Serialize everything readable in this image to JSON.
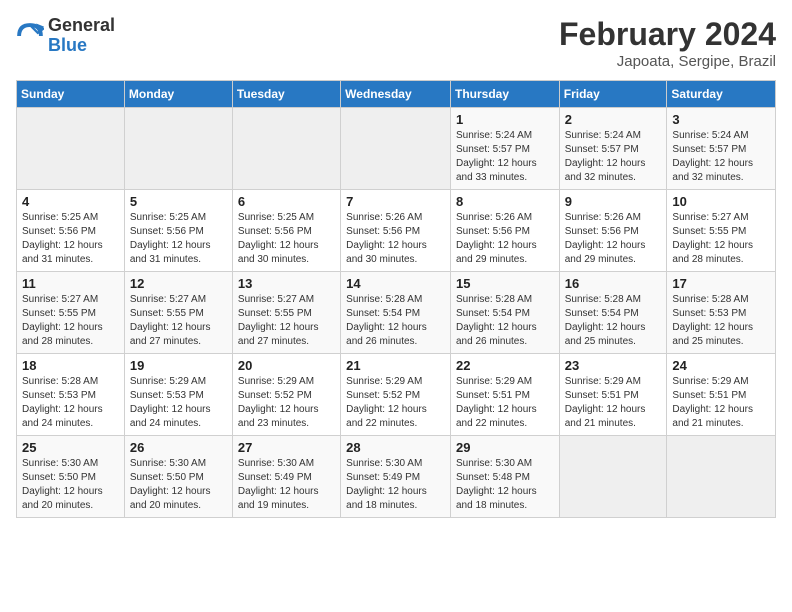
{
  "logo": {
    "line1": "General",
    "line2": "Blue"
  },
  "title": "February 2024",
  "location": "Japoata, Sergipe, Brazil",
  "headers": [
    "Sunday",
    "Monday",
    "Tuesday",
    "Wednesday",
    "Thursday",
    "Friday",
    "Saturday"
  ],
  "weeks": [
    [
      {
        "day": "",
        "info": ""
      },
      {
        "day": "",
        "info": ""
      },
      {
        "day": "",
        "info": ""
      },
      {
        "day": "",
        "info": ""
      },
      {
        "day": "1",
        "info": "Sunrise: 5:24 AM\nSunset: 5:57 PM\nDaylight: 12 hours and 33 minutes."
      },
      {
        "day": "2",
        "info": "Sunrise: 5:24 AM\nSunset: 5:57 PM\nDaylight: 12 hours and 32 minutes."
      },
      {
        "day": "3",
        "info": "Sunrise: 5:24 AM\nSunset: 5:57 PM\nDaylight: 12 hours and 32 minutes."
      }
    ],
    [
      {
        "day": "4",
        "info": "Sunrise: 5:25 AM\nSunset: 5:56 PM\nDaylight: 12 hours and 31 minutes."
      },
      {
        "day": "5",
        "info": "Sunrise: 5:25 AM\nSunset: 5:56 PM\nDaylight: 12 hours and 31 minutes."
      },
      {
        "day": "6",
        "info": "Sunrise: 5:25 AM\nSunset: 5:56 PM\nDaylight: 12 hours and 30 minutes."
      },
      {
        "day": "7",
        "info": "Sunrise: 5:26 AM\nSunset: 5:56 PM\nDaylight: 12 hours and 30 minutes."
      },
      {
        "day": "8",
        "info": "Sunrise: 5:26 AM\nSunset: 5:56 PM\nDaylight: 12 hours and 29 minutes."
      },
      {
        "day": "9",
        "info": "Sunrise: 5:26 AM\nSunset: 5:56 PM\nDaylight: 12 hours and 29 minutes."
      },
      {
        "day": "10",
        "info": "Sunrise: 5:27 AM\nSunset: 5:55 PM\nDaylight: 12 hours and 28 minutes."
      }
    ],
    [
      {
        "day": "11",
        "info": "Sunrise: 5:27 AM\nSunset: 5:55 PM\nDaylight: 12 hours and 28 minutes."
      },
      {
        "day": "12",
        "info": "Sunrise: 5:27 AM\nSunset: 5:55 PM\nDaylight: 12 hours and 27 minutes."
      },
      {
        "day": "13",
        "info": "Sunrise: 5:27 AM\nSunset: 5:55 PM\nDaylight: 12 hours and 27 minutes."
      },
      {
        "day": "14",
        "info": "Sunrise: 5:28 AM\nSunset: 5:54 PM\nDaylight: 12 hours and 26 minutes."
      },
      {
        "day": "15",
        "info": "Sunrise: 5:28 AM\nSunset: 5:54 PM\nDaylight: 12 hours and 26 minutes."
      },
      {
        "day": "16",
        "info": "Sunrise: 5:28 AM\nSunset: 5:54 PM\nDaylight: 12 hours and 25 minutes."
      },
      {
        "day": "17",
        "info": "Sunrise: 5:28 AM\nSunset: 5:53 PM\nDaylight: 12 hours and 25 minutes."
      }
    ],
    [
      {
        "day": "18",
        "info": "Sunrise: 5:28 AM\nSunset: 5:53 PM\nDaylight: 12 hours and 24 minutes."
      },
      {
        "day": "19",
        "info": "Sunrise: 5:29 AM\nSunset: 5:53 PM\nDaylight: 12 hours and 24 minutes."
      },
      {
        "day": "20",
        "info": "Sunrise: 5:29 AM\nSunset: 5:52 PM\nDaylight: 12 hours and 23 minutes."
      },
      {
        "day": "21",
        "info": "Sunrise: 5:29 AM\nSunset: 5:52 PM\nDaylight: 12 hours and 22 minutes."
      },
      {
        "day": "22",
        "info": "Sunrise: 5:29 AM\nSunset: 5:51 PM\nDaylight: 12 hours and 22 minutes."
      },
      {
        "day": "23",
        "info": "Sunrise: 5:29 AM\nSunset: 5:51 PM\nDaylight: 12 hours and 21 minutes."
      },
      {
        "day": "24",
        "info": "Sunrise: 5:29 AM\nSunset: 5:51 PM\nDaylight: 12 hours and 21 minutes."
      }
    ],
    [
      {
        "day": "25",
        "info": "Sunrise: 5:30 AM\nSunset: 5:50 PM\nDaylight: 12 hours and 20 minutes."
      },
      {
        "day": "26",
        "info": "Sunrise: 5:30 AM\nSunset: 5:50 PM\nDaylight: 12 hours and 20 minutes."
      },
      {
        "day": "27",
        "info": "Sunrise: 5:30 AM\nSunset: 5:49 PM\nDaylight: 12 hours and 19 minutes."
      },
      {
        "day": "28",
        "info": "Sunrise: 5:30 AM\nSunset: 5:49 PM\nDaylight: 12 hours and 18 minutes."
      },
      {
        "day": "29",
        "info": "Sunrise: 5:30 AM\nSunset: 5:48 PM\nDaylight: 12 hours and 18 minutes."
      },
      {
        "day": "",
        "info": ""
      },
      {
        "day": "",
        "info": ""
      }
    ]
  ]
}
